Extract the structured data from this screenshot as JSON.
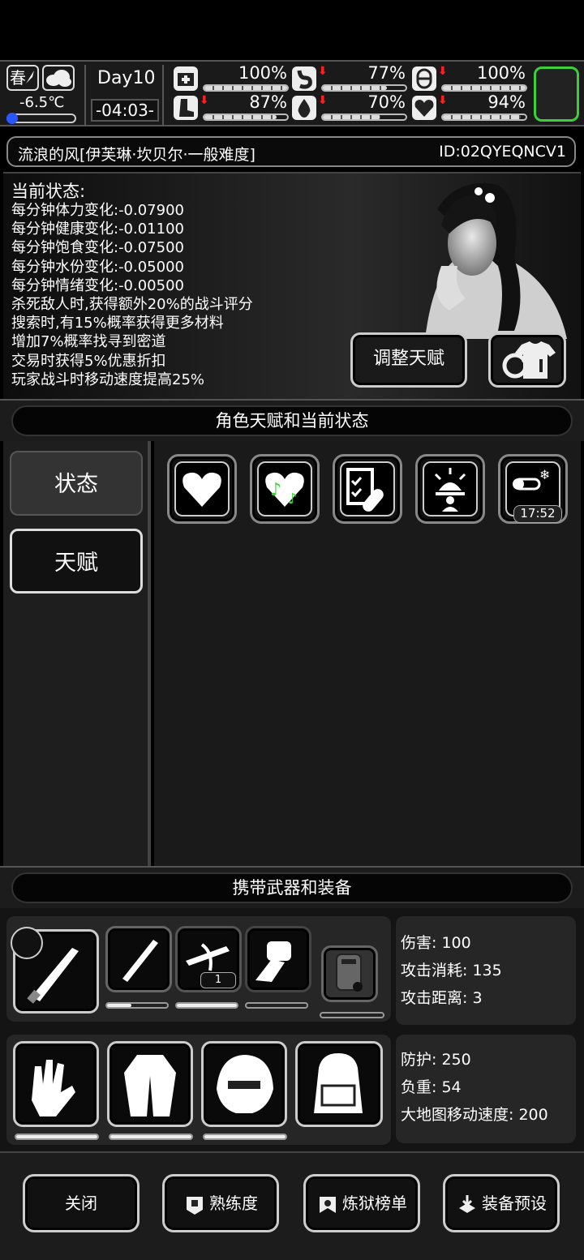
{
  "status_bar": {
    "season": "春",
    "temperature": "-6.5℃",
    "day": "Day10",
    "time": "-04:03-",
    "stats": [
      {
        "name": "health",
        "pct": "100%",
        "value": 1.0,
        "declining": false
      },
      {
        "name": "stomach",
        "pct": "77%",
        "value": 0.77,
        "declining": true
      },
      {
        "name": "pill",
        "pct": "100%",
        "value": 1.0,
        "declining": true
      },
      {
        "name": "stamina",
        "pct": "87%",
        "value": 0.87,
        "declining": true
      },
      {
        "name": "water",
        "pct": "70%",
        "value": 0.7,
        "declining": true
      },
      {
        "name": "mood",
        "pct": "94%",
        "value": 0.94,
        "declining": true
      }
    ]
  },
  "character": {
    "name": "流浪的风[伊芙琳·坎贝尔·一般难度]",
    "id": "ID:02QYEQNCV1"
  },
  "current_state": {
    "title": "当前状态:",
    "lines": [
      "每分钟体力变化:-0.07900",
      "每分钟健康变化:-0.01100",
      "每分钟饱食变化:-0.07500",
      "每分钟水份变化:-0.05000",
      "每分钟情绪变化:-0.00500",
      "杀死敌人时,获得额外20%的战斗评分",
      "搜索时,有15%概率获得更多材料",
      "增加7%概率找寻到密道",
      "交易时获得5%优惠折扣",
      "玩家战斗时移动速度提高25%"
    ],
    "adjust_talent_label": "调整天赋"
  },
  "section_talent": "角色天赋和当前状态",
  "tabs": {
    "state": "状态",
    "talent": "天赋"
  },
  "status_badges": {
    "timer": "17:52"
  },
  "section_equipment": "携带武器和装备",
  "weapon_stats": {
    "damage": "伤害: 100",
    "cost": "攻击消耗: 135",
    "range": "攻击距离: 3"
  },
  "ammo_count": "1",
  "armor_stats": {
    "defense": "防护: 250",
    "weight": "负重: 54",
    "speed": "大地图移动速度: 200"
  },
  "footer": {
    "close": "关闭",
    "proficiency": "熟练度",
    "ranking": "炼狱榜单",
    "preset": "装备预设"
  },
  "colors": {
    "accent_green": "#3ccf3c",
    "warning_red": "#ff2020",
    "temperature_blue": "#2b56ff"
  }
}
